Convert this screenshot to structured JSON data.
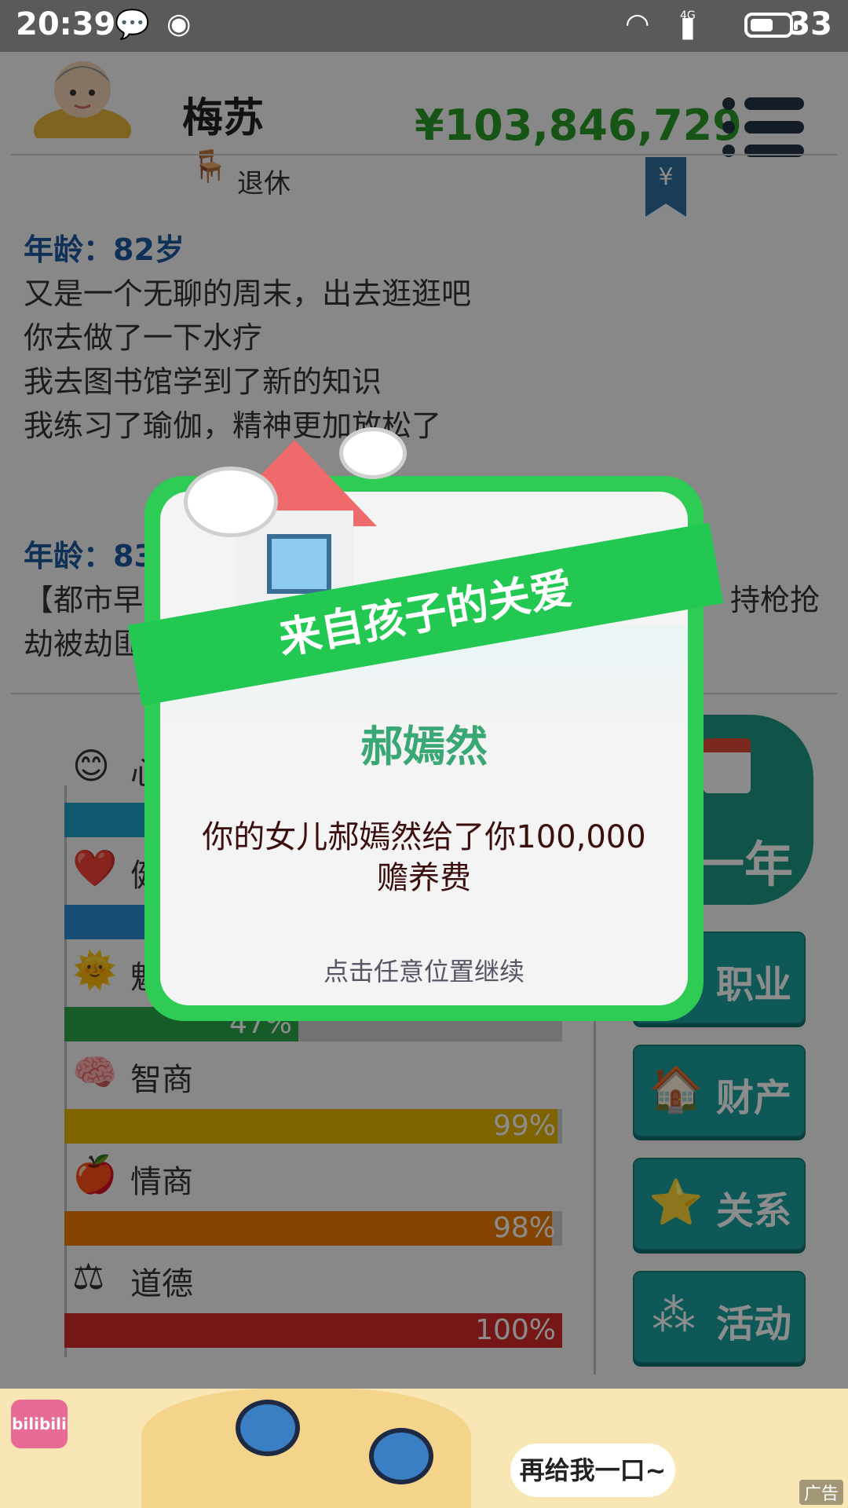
{
  "status_bar": {
    "time": "20:39",
    "network": "4G",
    "battery": "33"
  },
  "header": {
    "name": "梅苏",
    "status": "退休",
    "money": "¥103,846,729",
    "bookmark_symbol": "¥"
  },
  "log": [
    {
      "age": "年龄：82岁",
      "lines": [
        "又是一个无聊的周末，出去逛逛吧",
        "你去做了一下水疗",
        "我去图书馆学到了新的知识",
        "我练习了瑜伽，精神更加放松了"
      ]
    },
    {
      "age": "年龄：83",
      "lines": [
        "【都市早",
        "持枪抢",
        "劫被劫匪"
      ]
    }
  ],
  "stats": [
    {
      "label": "心",
      "icon": "smiley-icon",
      "percent_text": "",
      "value": 0.95,
      "color": "#1aa3c6"
    },
    {
      "label": "健",
      "icon": "heart-icon",
      "percent_text": "",
      "value": 0.95,
      "color": "#2d8fd8"
    },
    {
      "label": "魅",
      "icon": "sun-icon",
      "percent_text": "47%",
      "value": 0.47,
      "color": "#2aa84a"
    },
    {
      "label": "智商",
      "icon": "brain-icon",
      "percent_text": "99%",
      "value": 0.99,
      "color": "#e8b400"
    },
    {
      "label": "情商",
      "icon": "apple-icon",
      "percent_text": "98%",
      "value": 0.98,
      "color": "#ef7d00"
    },
    {
      "label": "道德",
      "icon": "scales-icon",
      "percent_text": "100%",
      "value": 1.0,
      "color": "#d62b2b"
    }
  ],
  "side": {
    "next_year": "一年",
    "buttons": [
      {
        "label": "职业",
        "icon": "briefcase-icon"
      },
      {
        "label": "财产",
        "icon": "house-icon"
      },
      {
        "label": "关系",
        "icon": "star-icon"
      },
      {
        "label": "活动",
        "icon": "activity-icon"
      }
    ]
  },
  "ad": {
    "brand": "bilibili",
    "bubble": "再给我一口~",
    "tag": "广告"
  },
  "modal": {
    "title": "来自孩子的关爱",
    "child_name": "郝嫣然",
    "message": "你的女儿郝嫣然给了你100,000赡养费",
    "hint": "点击任意位置继续"
  }
}
